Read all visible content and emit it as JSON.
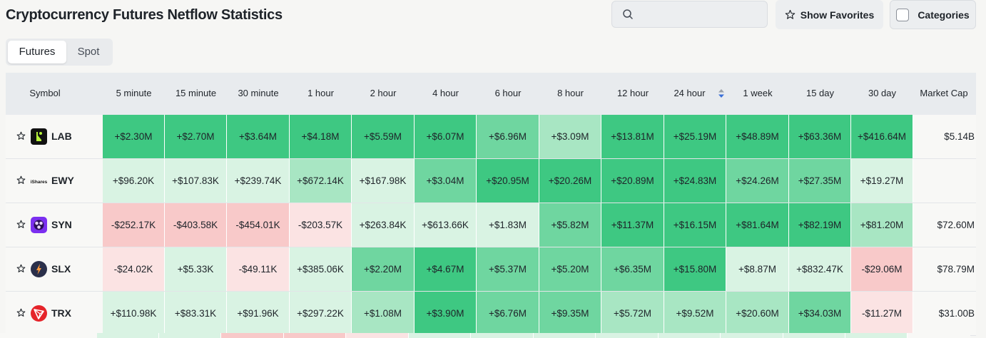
{
  "page": {
    "title": "Cryptocurrency Futures Netflow Statistics"
  },
  "toolbar": {
    "search_placeholder": "",
    "show_favorites_label": "Show Favorites",
    "categories_label": "Categories"
  },
  "tabs": [
    {
      "label": "Futures",
      "active": true
    },
    {
      "label": "Spot",
      "active": false
    }
  ],
  "columns": [
    "Symbol",
    "5 minute",
    "15 minute",
    "30 minute",
    "1 hour",
    "2 hour",
    "4 hour",
    "6 hour",
    "8 hour",
    "12 hour",
    "24 hour",
    "1 week",
    "15 day",
    "30 day",
    "Market Cap"
  ],
  "sorted_column": "24 hour",
  "colors": {
    "green_strong": "#3ec882",
    "green_mid": "#6fd6a0",
    "green_light": "#a8e6c3",
    "green_faint": "#d9f3e3",
    "red_faint": "#fbe3e3",
    "red_light": "#f8c9c9",
    "sort_arrow": "#3a6fd8"
  },
  "rows": [
    {
      "symbol": "LAB",
      "logo": "lab-logo-icon",
      "logo_color": "#111111",
      "values": [
        "+$2.30M",
        "+$2.70M",
        "+$3.64M",
        "+$4.18M",
        "+$5.59M",
        "+$6.07M",
        "+$6.96M",
        "+$3.09M",
        "+$13.81M",
        "+$25.19M",
        "+$48.89M",
        "+$63.36M",
        "+$416.64M"
      ],
      "shades": [
        "gs",
        "gs",
        "gs",
        "gs",
        "gs",
        "gs",
        "gm",
        "gl",
        "gs",
        "gs",
        "gs",
        "gs",
        "gs"
      ],
      "market_cap": "$5.14B"
    },
    {
      "symbol": "EWY",
      "logo": "ishares-logo-icon",
      "logo_text": "iShares",
      "logo_color": "#ffffff",
      "values": [
        "+$96.20K",
        "+$107.83K",
        "+$239.74K",
        "+$672.14K",
        "+$167.98K",
        "+$3.04M",
        "+$20.95M",
        "+$20.26M",
        "+$20.89M",
        "+$24.83M",
        "+$24.26M",
        "+$27.35M",
        "+$19.27M"
      ],
      "shades": [
        "gf",
        "gf",
        "gf",
        "gl",
        "gf",
        "gm",
        "gs",
        "gs",
        "gs",
        "gs",
        "gm",
        "gm",
        "gf"
      ],
      "market_cap": ""
    },
    {
      "symbol": "SYN",
      "logo": "syn-logo-icon",
      "logo_color": "#7b2ff0",
      "values": [
        "-$252.17K",
        "-$403.58K",
        "-$454.01K",
        "-$203.57K",
        "+$263.84K",
        "+$613.66K",
        "+$1.83M",
        "+$5.82M",
        "+$11.37M",
        "+$16.15M",
        "+$81.64M",
        "+$82.19M",
        "+$81.20M"
      ],
      "shades": [
        "rl",
        "rl",
        "rl",
        "rf",
        "gf",
        "gf",
        "gf",
        "gm",
        "gs",
        "gs",
        "gs",
        "gs",
        "gl"
      ],
      "market_cap": "$72.60M"
    },
    {
      "symbol": "SLX",
      "logo": "slx-logo-icon",
      "logo_color": "#2a2f4a",
      "values": [
        "-$24.02K",
        "+$5.33K",
        "-$49.11K",
        "+$385.06K",
        "+$2.20M",
        "+$4.67M",
        "+$5.37M",
        "+$5.20M",
        "+$6.35M",
        "+$15.80M",
        "+$8.87M",
        "+$832.47K",
        "-$29.06M"
      ],
      "shades": [
        "rf",
        "gf",
        "rf",
        "gf",
        "gm",
        "gs",
        "gm",
        "gm",
        "gm",
        "gs",
        "gf",
        "gf",
        "rl"
      ],
      "market_cap": "$78.79M"
    },
    {
      "symbol": "TRX",
      "logo": "tron-logo-icon",
      "logo_color": "#e5242a",
      "values": [
        "+$110.98K",
        "+$83.31K",
        "+$91.96K",
        "+$297.22K",
        "+$1.08M",
        "+$3.90M",
        "+$6.76M",
        "+$9.35M",
        "+$5.72M",
        "+$9.52M",
        "+$20.60M",
        "+$34.03M",
        "-$11.27M"
      ],
      "shades": [
        "gf",
        "gf",
        "gf",
        "gf",
        "gl",
        "gs",
        "gm",
        "gm",
        "gl",
        "gl",
        "gl",
        "gm",
        "rf"
      ],
      "market_cap": "$31.00B"
    }
  ]
}
